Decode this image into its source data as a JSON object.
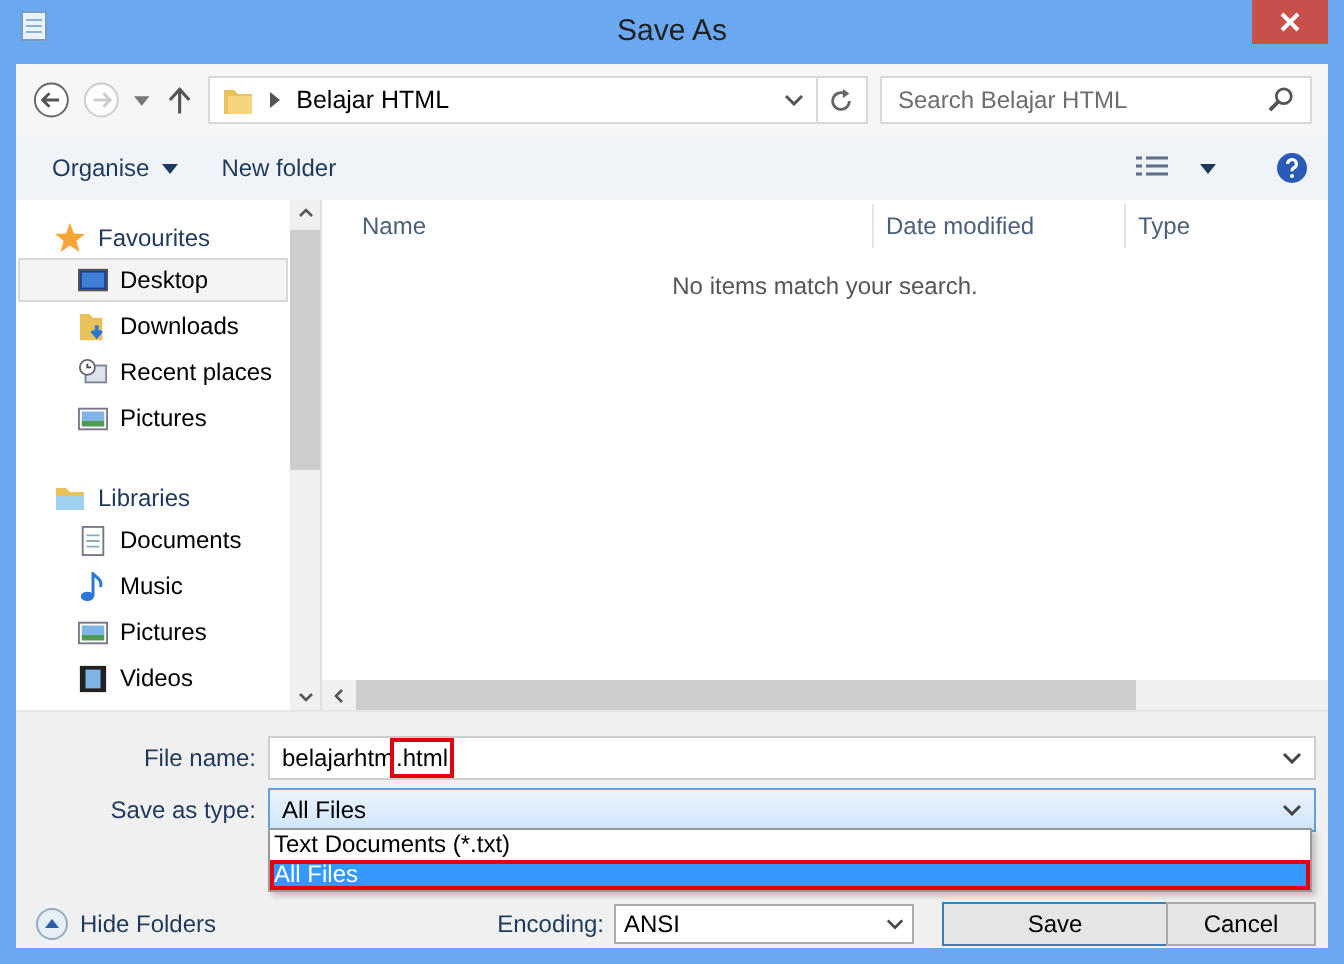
{
  "window": {
    "title": "Save As"
  },
  "nav": {
    "path": "Belajar HTML",
    "search_placeholder": "Search Belajar HTML",
    "back_disabled": false,
    "forward_disabled": true
  },
  "toolbar": {
    "organise": "Organise",
    "new_folder": "New folder"
  },
  "sidebar": {
    "groups": [
      {
        "label": "Favourites",
        "kind": "star",
        "children": [
          {
            "label": "Desktop",
            "kind": "desktop",
            "selected": true
          },
          {
            "label": "Downloads",
            "kind": "downloads",
            "selected": false
          },
          {
            "label": "Recent places",
            "kind": "recent",
            "selected": false
          },
          {
            "label": "Pictures",
            "kind": "pictures",
            "selected": false
          }
        ]
      },
      {
        "label": "Libraries",
        "kind": "libraries",
        "children": [
          {
            "label": "Documents",
            "kind": "documents",
            "selected": false
          },
          {
            "label": "Music",
            "kind": "music",
            "selected": false
          },
          {
            "label": "Pictures",
            "kind": "pictures",
            "selected": false
          },
          {
            "label": "Videos",
            "kind": "videos",
            "selected": false
          }
        ]
      }
    ]
  },
  "file_list": {
    "columns": [
      "Name",
      "Date modified",
      "Type"
    ],
    "empty_message": "No items match your search."
  },
  "form": {
    "file_name_label": "File name:",
    "file_name_value": "belajarhtm",
    "file_name_highlighted": ".html",
    "type_label": "Save as type:",
    "type_value": "All Files",
    "type_options": [
      {
        "label": "Text Documents (*.txt)",
        "selected": false
      },
      {
        "label": "All Files",
        "selected": true
      }
    ],
    "encoding_label": "Encoding:",
    "encoding_value": "ANSI"
  },
  "footer": {
    "hide_folders": "Hide Folders",
    "buttons": [
      "Save",
      "Cancel"
    ]
  }
}
